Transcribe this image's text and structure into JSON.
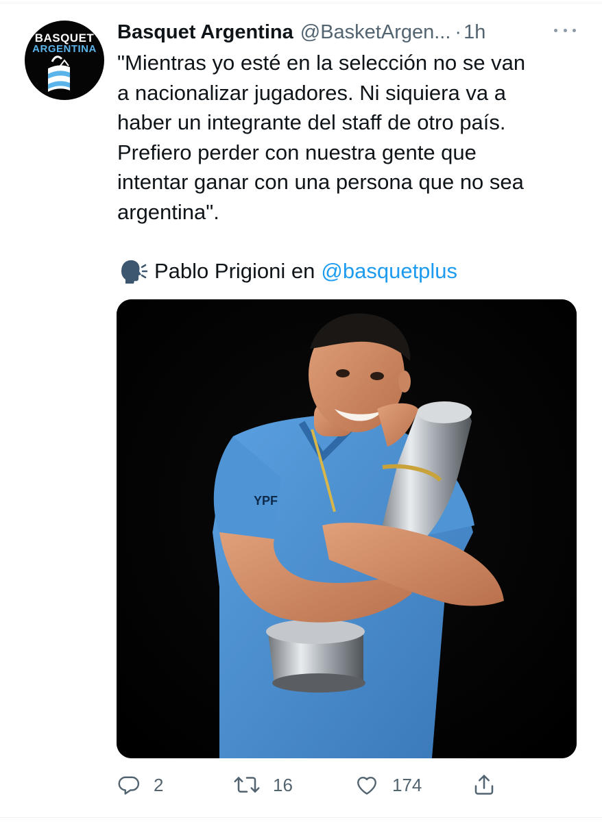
{
  "author": {
    "display_name": "Basquet Argentina",
    "handle": "@BasketArgen...",
    "separator": "·",
    "time": "1h",
    "avatar": {
      "line1": "BASQUET",
      "line2": "ARGENTINA",
      "line1_color": "#ffffff",
      "line2_color": "#5ab4ea"
    },
    "more_icon": "more-horizontal-icon"
  },
  "tweet": {
    "lines": [
      "\"Mientras yo esté en la selección no se van",
      "a nacionalizar jugadores. Ni siquiera va a",
      "haber un integrante del staff de otro país.",
      "Prefiero perder con nuestra gente que",
      "intentar ganar con una persona que no sea",
      "argentina\"."
    ],
    "credit": {
      "icon": "speaking-head-icon",
      "text": "Pablo Prigioni en",
      "mention": "@basquetplus"
    },
    "media": {
      "icon": "photo-player-with-trophy",
      "jersey_text": "YPF"
    }
  },
  "actions": {
    "reply": {
      "icon": "reply-icon",
      "count": "2"
    },
    "retweet": {
      "icon": "retweet-icon",
      "count": "16"
    },
    "like": {
      "icon": "heart-icon",
      "count": "174"
    },
    "share": {
      "icon": "share-icon"
    }
  },
  "colors": {
    "text": "#0f1419",
    "secondary": "#536471",
    "link": "#1d9bf0",
    "media_background": "#000000",
    "jersey": "#4a8fd0"
  }
}
